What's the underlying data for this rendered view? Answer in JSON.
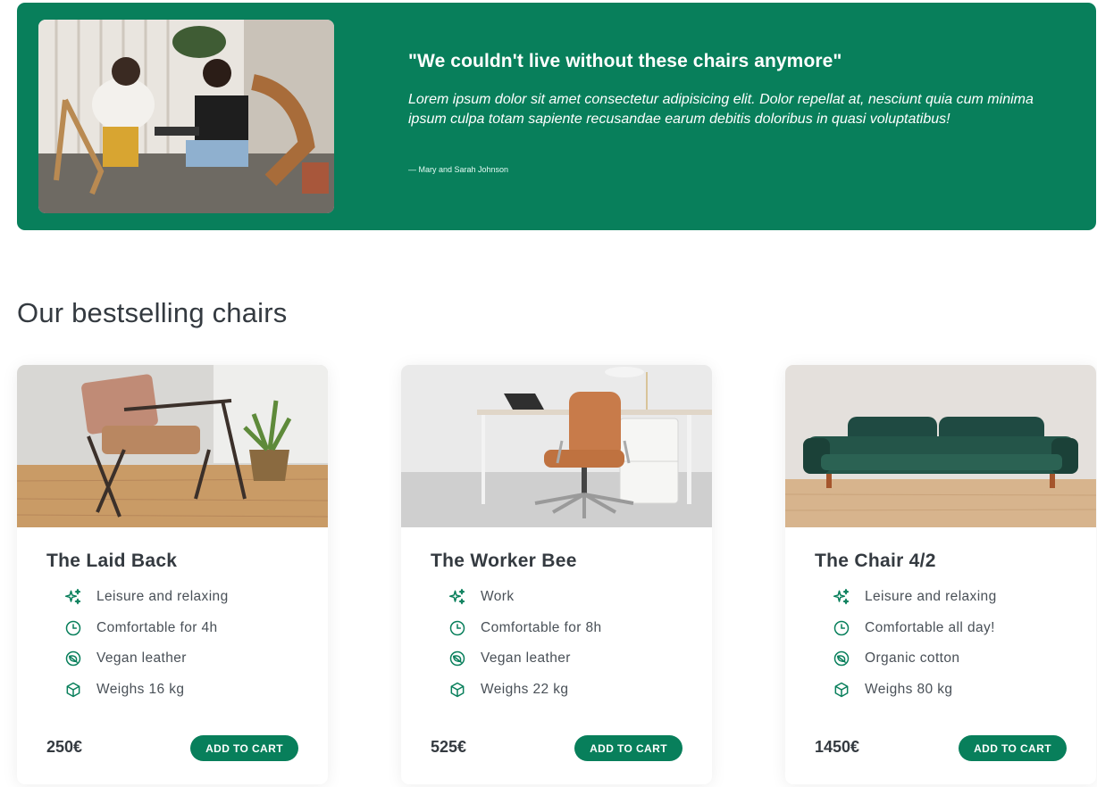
{
  "testimonial": {
    "quote": "\"We couldn't live without these chairs anymore\"",
    "text": "Lorem ipsum dolor sit amet consectetur adipisicing elit. Dolor repellat at, nesciunt quia cum minima ipsum culpa totam sapiente recusandae earum debitis doloribus in quasi voluptatibus!",
    "author": "— Mary and Sarah Johnson"
  },
  "section_title": "Our bestselling chairs",
  "products": [
    {
      "name": "The Laid Back",
      "features": [
        {
          "icon": "sparkles-icon",
          "label": "Leisure and relaxing"
        },
        {
          "icon": "clock-icon",
          "label": "Comfortable for 4h"
        },
        {
          "icon": "leaf-icon",
          "label": "Vegan leather"
        },
        {
          "icon": "box-icon",
          "label": "Weighs 16 kg"
        }
      ],
      "price": "250€",
      "button": "ADD TO CART"
    },
    {
      "name": "The Worker Bee",
      "features": [
        {
          "icon": "sparkles-icon",
          "label": "Work"
        },
        {
          "icon": "clock-icon",
          "label": "Comfortable for 8h"
        },
        {
          "icon": "leaf-icon",
          "label": "Vegan leather"
        },
        {
          "icon": "box-icon",
          "label": "Weighs 22 kg"
        }
      ],
      "price": "525€",
      "button": "ADD TO CART"
    },
    {
      "name": "The Chair 4/2",
      "features": [
        {
          "icon": "sparkles-icon",
          "label": "Leisure and relaxing"
        },
        {
          "icon": "clock-icon",
          "label": "Comfortable all day!"
        },
        {
          "icon": "leaf-icon",
          "label": "Organic cotton"
        },
        {
          "icon": "box-icon",
          "label": "Weighs 80 kg"
        }
      ],
      "price": "1450€",
      "button": "ADD TO CART"
    }
  ],
  "colors": {
    "brand": "#087f5b",
    "text_dark": "#343a40",
    "text": "#495057"
  }
}
